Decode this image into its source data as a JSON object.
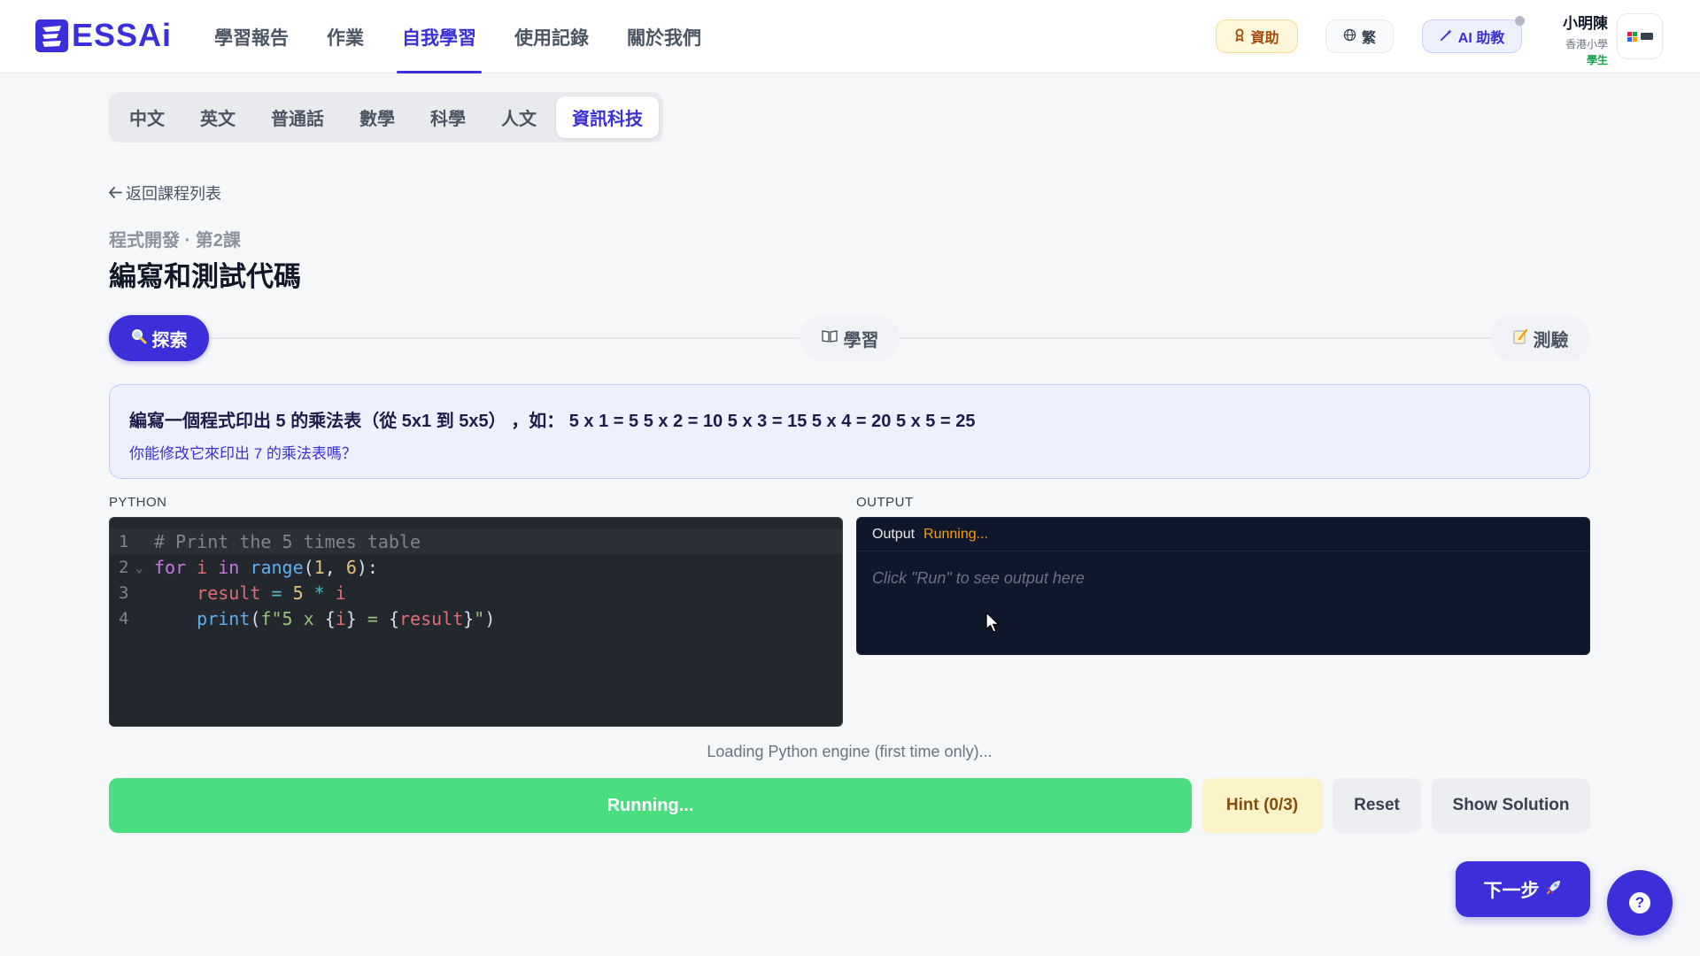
{
  "brand": {
    "name": "ESSAi",
    "color": "#3b2fd9"
  },
  "nav": {
    "items": [
      {
        "label": "學習報告",
        "active": false
      },
      {
        "label": "作業",
        "active": false
      },
      {
        "label": "自我學習",
        "active": true
      },
      {
        "label": "使用記錄",
        "active": false
      },
      {
        "label": "關於我們",
        "active": false
      }
    ]
  },
  "header_actions": {
    "sponsor_label": "資助",
    "sponsor_icon": "ribbon-icon",
    "lang_label": "繁",
    "lang_icon": "globe-icon",
    "ai_label": "AI 助教",
    "ai_icon": "magic-wand-icon"
  },
  "user": {
    "name": "小明陳",
    "school": "香港小學",
    "role": "學生"
  },
  "subjects": {
    "tabs": [
      {
        "label": "中文",
        "active": false
      },
      {
        "label": "英文",
        "active": false
      },
      {
        "label": "普通話",
        "active": false
      },
      {
        "label": "數學",
        "active": false
      },
      {
        "label": "科學",
        "active": false
      },
      {
        "label": "人文",
        "active": false
      },
      {
        "label": "資訊科技",
        "active": true
      }
    ]
  },
  "lesson": {
    "back_label": "返回課程列表",
    "subtitle": "程式開發 · 第2課",
    "title": "編寫和測試代碼"
  },
  "steps": {
    "explore": {
      "label": "探索",
      "icon": "magnifier-icon",
      "active": true
    },
    "learn": {
      "label": "學習",
      "icon": "book-icon",
      "active": false
    },
    "quiz": {
      "label": "測驗",
      "icon": "memo-icon",
      "active": false
    }
  },
  "task": {
    "main": "編寫一個程式印出 5 的乘法表（從 5x1 到 5x5） ，如： 5 x 1 = 5 5 x 2 = 10 5 x 3 = 15 5 x 4 = 20 5 x 5 = 25",
    "sub": "你能修改它來印出 7 的乘法表嗎？"
  },
  "editor": {
    "label": "PYTHON",
    "line_numbers": [
      "1",
      "2",
      "3",
      "4"
    ],
    "lines": [
      "# Print the 5 times table",
      "for i in range(1, 6):",
      "    result = 5 * i",
      "    print(f\"5 x {i} = {result}\")"
    ]
  },
  "output": {
    "label": "OUTPUT",
    "title": "Output",
    "status": "Running...",
    "placeholder": "Click \"Run\" to see output here"
  },
  "controls": {
    "loading_text": "Loading Python engine (first time only)...",
    "run_label": "Running...",
    "hint_label": "Hint (0/3)",
    "reset_label": "Reset",
    "solution_label": "Show Solution",
    "next_label": "下一步",
    "next_icon": "rocket-icon",
    "help_label": "?"
  }
}
